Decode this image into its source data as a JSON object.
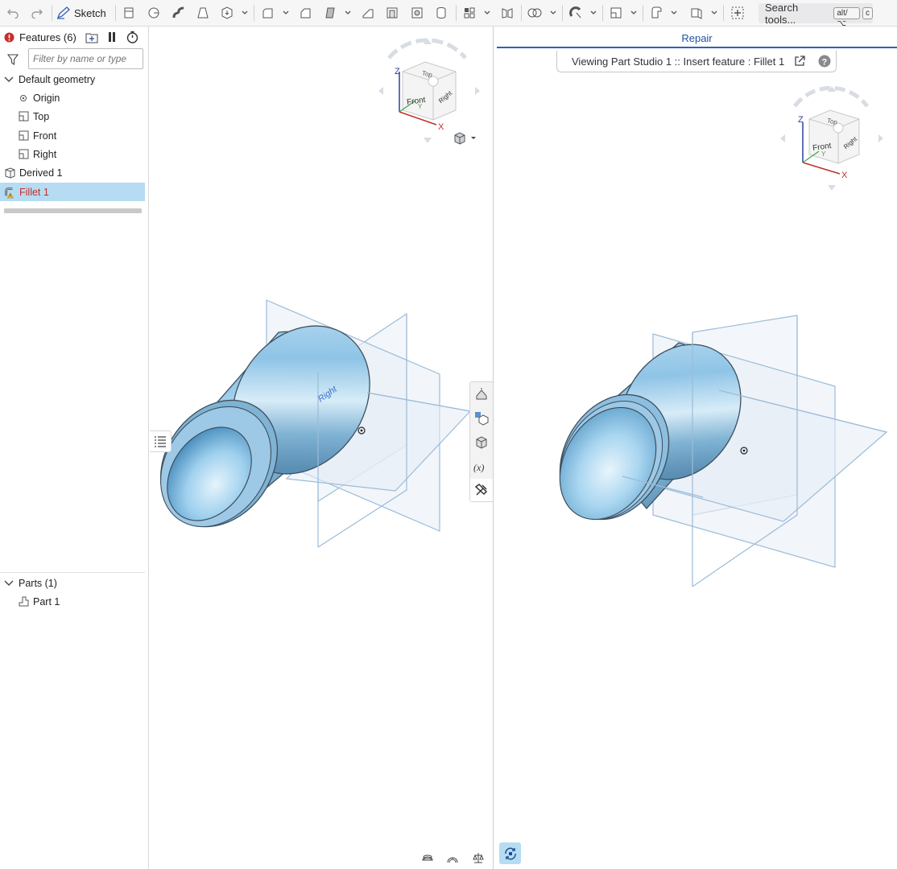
{
  "toolbar": {
    "sketch_label": "Sketch",
    "search_label": "Search tools...",
    "shortcut_key1": "alt/⌥",
    "shortcut_key2": "c"
  },
  "features": {
    "title": "Features (6)",
    "filter_placeholder": "Filter by name or type",
    "default_geometry": "Default geometry",
    "origin": "Origin",
    "top": "Top",
    "front": "Front",
    "right": "Right",
    "derived": "Derived 1",
    "fillet": "Fillet 1"
  },
  "parts": {
    "title": "Parts (1)",
    "part1": "Part 1"
  },
  "repair": {
    "tab_label": "Repair",
    "viewing_text": "Viewing Part Studio 1 :: Insert feature : Fillet 1"
  },
  "viewcube": {
    "top": "Top",
    "front": "Front",
    "right": "Right",
    "z": "Z",
    "x": "X",
    "y": "Y"
  },
  "plane_label": "Right",
  "colors": {
    "accent": "#2e62b8",
    "selection": "#b5dcf2",
    "error": "#c4302b",
    "part": "#8fc4e6"
  }
}
